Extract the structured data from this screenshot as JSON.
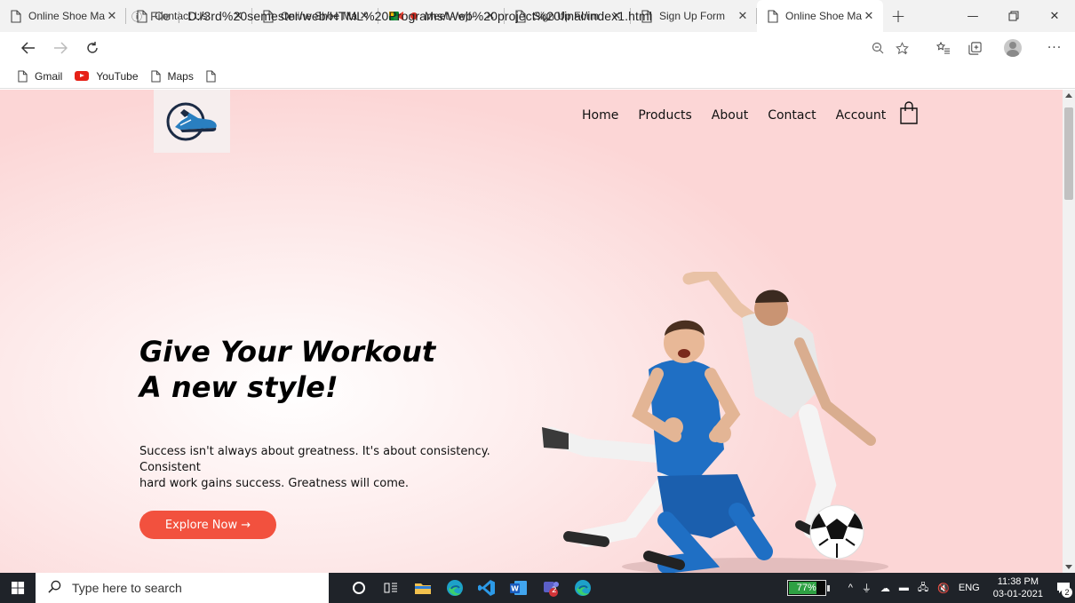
{
  "browser": {
    "tabs": [
      {
        "title": "Online Shoe Ma",
        "icon": "page-icon",
        "active": false
      },
      {
        "title": "Contact Us",
        "icon": "page-icon",
        "active": false
      },
      {
        "title": "Online Shoe Ma",
        "icon": "page-icon",
        "active": false
      },
      {
        "title": "Meet - wjf-",
        "icon": "meet-icon",
        "active": false
      },
      {
        "title": "Sign Up Form",
        "icon": "page-icon",
        "active": false
      },
      {
        "title": "Sign Up Form",
        "icon": "page-icon",
        "active": false
      },
      {
        "title": "Online Shoe Ma",
        "icon": "page-icon",
        "active": true
      }
    ],
    "address": {
      "scheme_label": "File",
      "url": "D:/3rd%20semester/web/HTML%20Programs/Web%20project%20final/index1.html"
    },
    "bookmarks": [
      {
        "label": "Gmail",
        "icon": "page-icon"
      },
      {
        "label": "YouTube",
        "icon": "youtube-icon"
      },
      {
        "label": "Maps",
        "icon": "page-icon"
      },
      {
        "label": "",
        "icon": "page-icon"
      }
    ]
  },
  "site": {
    "nav": [
      "Home",
      "Products",
      "About",
      "Contact",
      "Account"
    ],
    "hero": {
      "title_line1": "Give Your Workout",
      "title_line2": "A new style!",
      "text_line1": "Success isn't always about greatness. It's about consistency.",
      "text_line2": "Consistent",
      "text_line3": "hard work gains success. Greatness will come.",
      "cta": "Explore Now →",
      "accent_color": "#f2513e"
    }
  },
  "taskbar": {
    "search_placeholder": "Type here to search",
    "battery_percent": 77,
    "battery_label": "77%",
    "language": "ENG",
    "time": "11:38 PM",
    "date": "03-01-2021",
    "notification_count": "2",
    "teams_badge": "2"
  }
}
